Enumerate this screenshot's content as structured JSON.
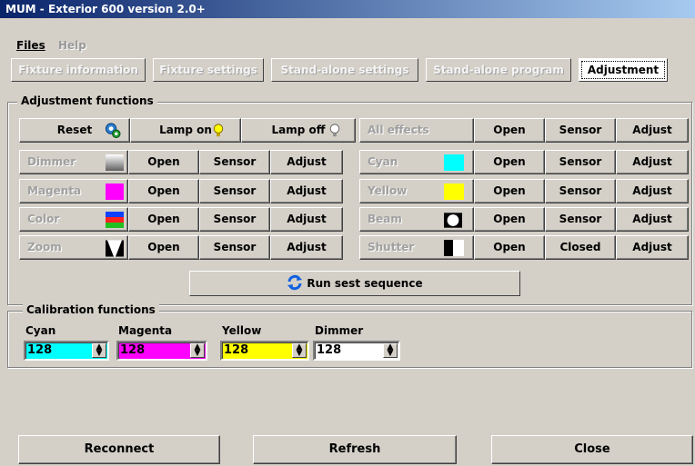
{
  "window": {
    "title": "MUM - Exterior 600 version 2.0+"
  },
  "menu": {
    "files": "Files",
    "help": "Help"
  },
  "tabs": [
    {
      "label": "Fixture information",
      "state": "disabled"
    },
    {
      "label": "Fixture settings",
      "state": "disabled"
    },
    {
      "label": "Stand-alone settings",
      "state": "disabled"
    },
    {
      "label": "Stand-alone program",
      "state": "disabled"
    },
    {
      "label": "Adjustment",
      "state": "active"
    }
  ],
  "adjustment": {
    "legend": "Adjustment functions",
    "reset": "Reset",
    "lamp_on": "Lamp on",
    "lamp_off": "Lamp off",
    "all_effects": "All effects",
    "open": "Open",
    "sensor": "Sensor",
    "adjust": "Adjust",
    "closed": "Closed",
    "left_rows": [
      "Dimmer",
      "Magenta",
      "Color",
      "Zoom"
    ],
    "right_rows": [
      "Cyan",
      "Yellow",
      "Beam",
      "Shutter"
    ],
    "run_sequence": "Run sest sequence"
  },
  "calibration": {
    "legend": "Calibration functions",
    "fields": [
      {
        "label": "Cyan",
        "value": "128",
        "color": "#00ffff"
      },
      {
        "label": "Magenta",
        "value": "128",
        "color": "#ff00ff"
      },
      {
        "label": "Yellow",
        "value": "128",
        "color": "#ffff00"
      },
      {
        "label": "Dimmer",
        "value": "128",
        "color": "#ffffff"
      }
    ]
  },
  "bottom": {
    "reconnect": "Reconnect",
    "refresh": "Refresh",
    "close": "Close"
  },
  "colors": {
    "cyan": "#00ffff",
    "magenta": "#ff00ff",
    "yellow": "#ffff00"
  },
  "icons": [
    "gear-icon",
    "lightbulb-on-icon",
    "lightbulb-off-icon",
    "refresh-icon",
    "spinner-arrows-icon"
  ]
}
